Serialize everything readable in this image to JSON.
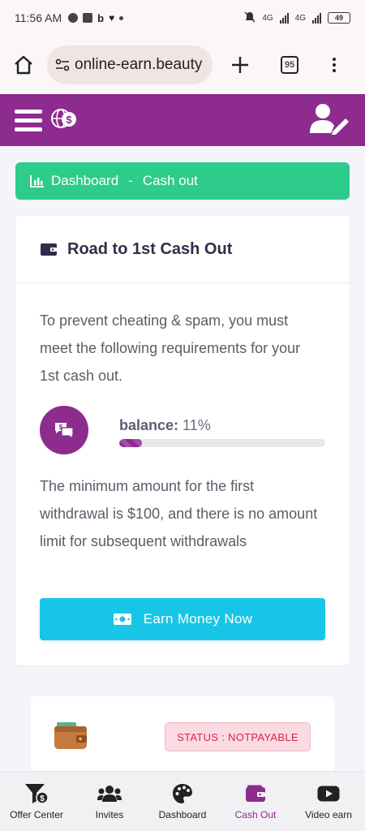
{
  "status_bar": {
    "time": "11:56 AM",
    "net1": "4G",
    "net2": "4G",
    "battery": "49"
  },
  "browser": {
    "url": "online-earn.beauty",
    "tab_count": "95"
  },
  "breadcrumb": {
    "home": "Dashboard",
    "separator": "-",
    "current": "Cash out"
  },
  "card": {
    "title": "Road to 1st Cash Out",
    "intro": "To prevent cheating & spam, you must meet the following requirements for your 1st cash out.",
    "balance_label": "balance:",
    "balance_value": "11%",
    "balance_progress": 11,
    "minimum_text": "The minimum amount for the first withdrawal is $100, and there is no amount limit for subsequent withdrawals",
    "earn_button": "Earn Money Now"
  },
  "status_card": {
    "status": "STATUS : NOTPAYABLE"
  },
  "bottom_nav": [
    {
      "label": "Offer Center",
      "icon": "funnel-dollar-icon"
    },
    {
      "label": "Invites",
      "icon": "users-icon"
    },
    {
      "label": "Dashboard",
      "icon": "palette-icon"
    },
    {
      "label": "Cash Out",
      "icon": "wallet-icon",
      "active": true
    },
    {
      "label": "Video earn",
      "icon": "youtube-icon"
    }
  ],
  "colors": {
    "primary": "#8e2b8f",
    "success": "#2ecc8a",
    "info": "#17c6e6",
    "danger": "#d7254a"
  }
}
